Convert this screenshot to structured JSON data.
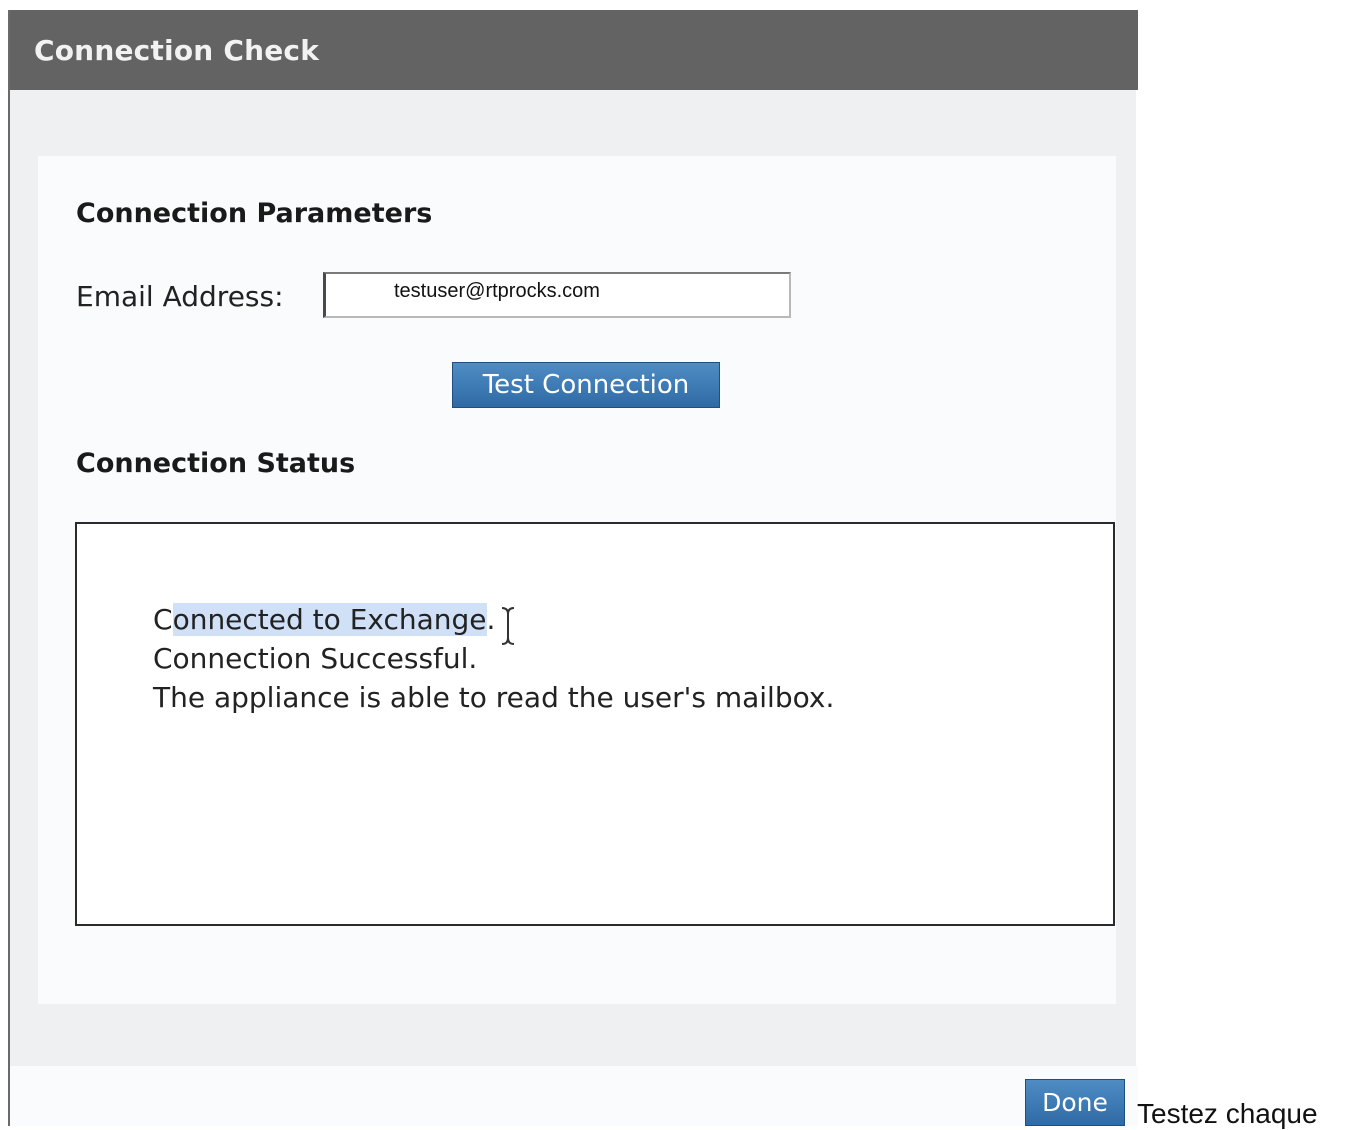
{
  "dialog": {
    "title": "Connection Check"
  },
  "parameters": {
    "heading": "Connection Parameters",
    "email_label": "Email Address:",
    "email_value": "testuser@rtprocks.com",
    "test_button_label": "Test Connection"
  },
  "status": {
    "heading": "Connection Status",
    "line1_first": "C",
    "line1_selected": "onnected to Exchange",
    "line1_end": ".",
    "line2": "Connection Successful.",
    "line3": "The appliance is able to read the user's mailbox."
  },
  "footer": {
    "done_label": "Done"
  },
  "caption": "Testez chaque",
  "colors": {
    "titlebar": "#636363",
    "button": "#3a78b4",
    "selection": "#cfe0f7"
  }
}
